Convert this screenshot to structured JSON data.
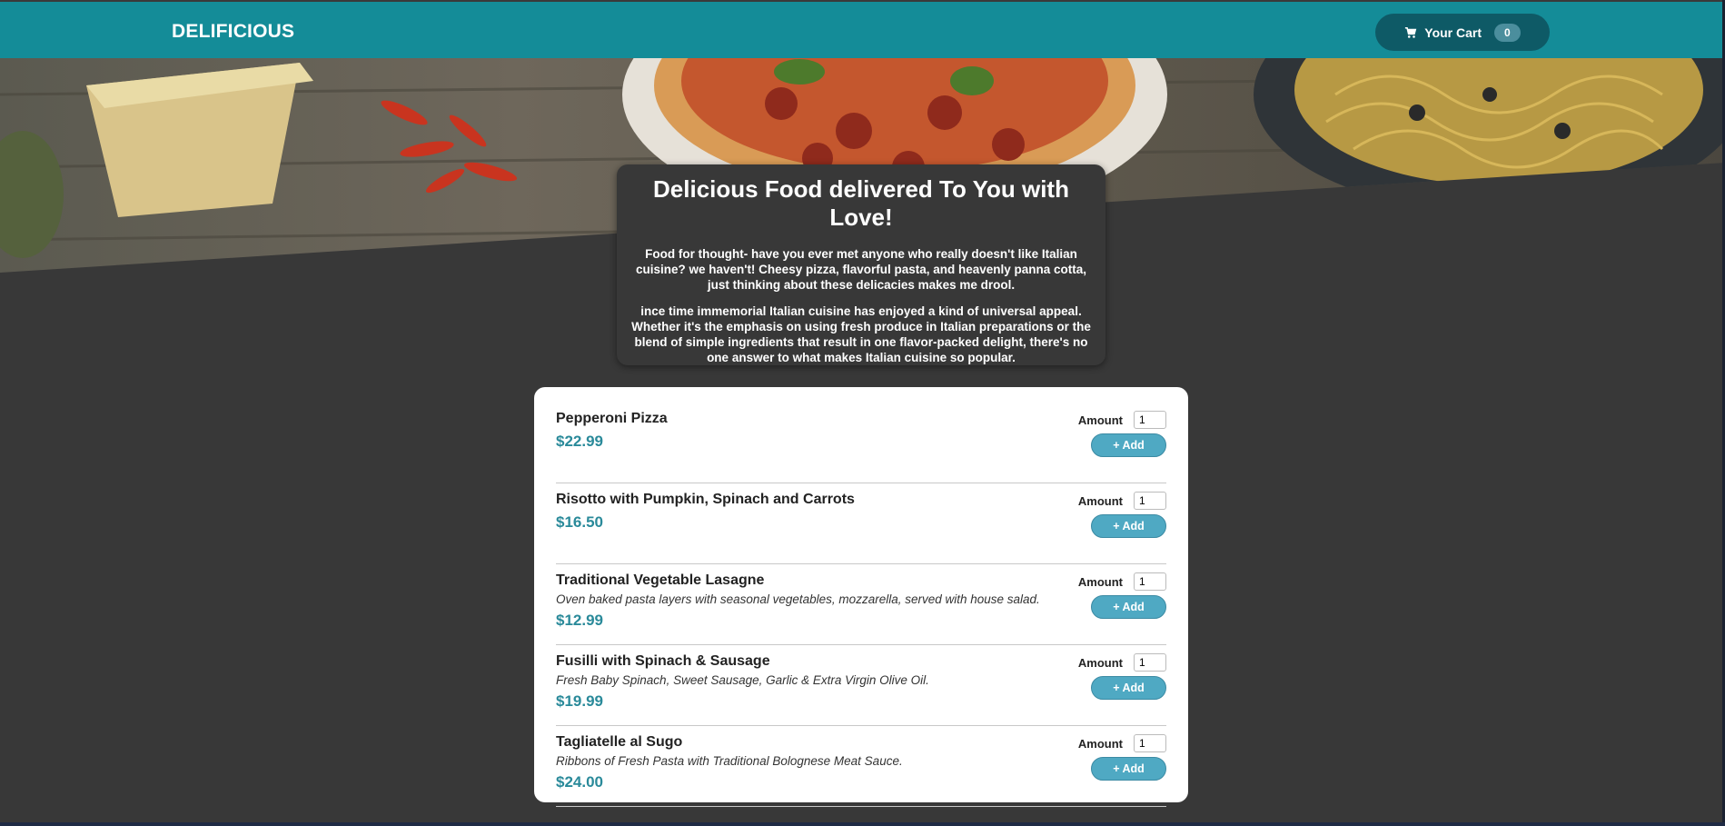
{
  "header": {
    "logo": "DELIFICIOUS",
    "cart_label": "Your Cart",
    "cart_count": "0",
    "cart_icon": "cart-icon"
  },
  "summary": {
    "title": "Delicious Food delivered To You with Love!",
    "para1": "Food for thought- have you ever met anyone who really doesn't like Italian cuisine? we haven't! Cheesy pizza, flavorful pasta, and heavenly panna cotta, just thinking about these delicacies makes me drool.",
    "para2": "ince time immemorial Italian cuisine has enjoyed a kind of universal appeal. Whether it's the emphasis on using fresh produce in Italian preparations or the blend of simple ingredients that result in one flavor-packed delight, there's no one answer to what makes Italian cuisine so popular."
  },
  "menu": {
    "amount_label": "Amount",
    "add_label": "+ Add",
    "meals": [
      {
        "name": "Pepperoni Pizza",
        "description": "",
        "price": "$22.99",
        "amount": "1"
      },
      {
        "name": "Risotto with Pumpkin, Spinach and Carrots",
        "description": "",
        "price": "$16.50",
        "amount": "1"
      },
      {
        "name": "Traditional Vegetable Lasagne",
        "description": "Oven baked pasta layers with seasonal vegetables, mozzarella, served with house salad.",
        "price": "$12.99",
        "amount": "1"
      },
      {
        "name": "Fusilli with Spinach & Sausage",
        "description": "Fresh Baby Spinach, Sweet Sausage, Garlic & Extra Virgin Olive Oil.",
        "price": "$19.99",
        "amount": "1"
      },
      {
        "name": "Tagliatelle al Sugo",
        "description": "Ribbons of Fresh Pasta with Traditional Bolognese Meat Sauce.",
        "price": "$24.00",
        "amount": "1"
      }
    ]
  },
  "colors": {
    "header_bg": "#148c98",
    "cart_button_bg": "#0e5a66",
    "page_bg": "#383838",
    "price": "#2a8a9a",
    "add_button": "#4fa9c3"
  }
}
